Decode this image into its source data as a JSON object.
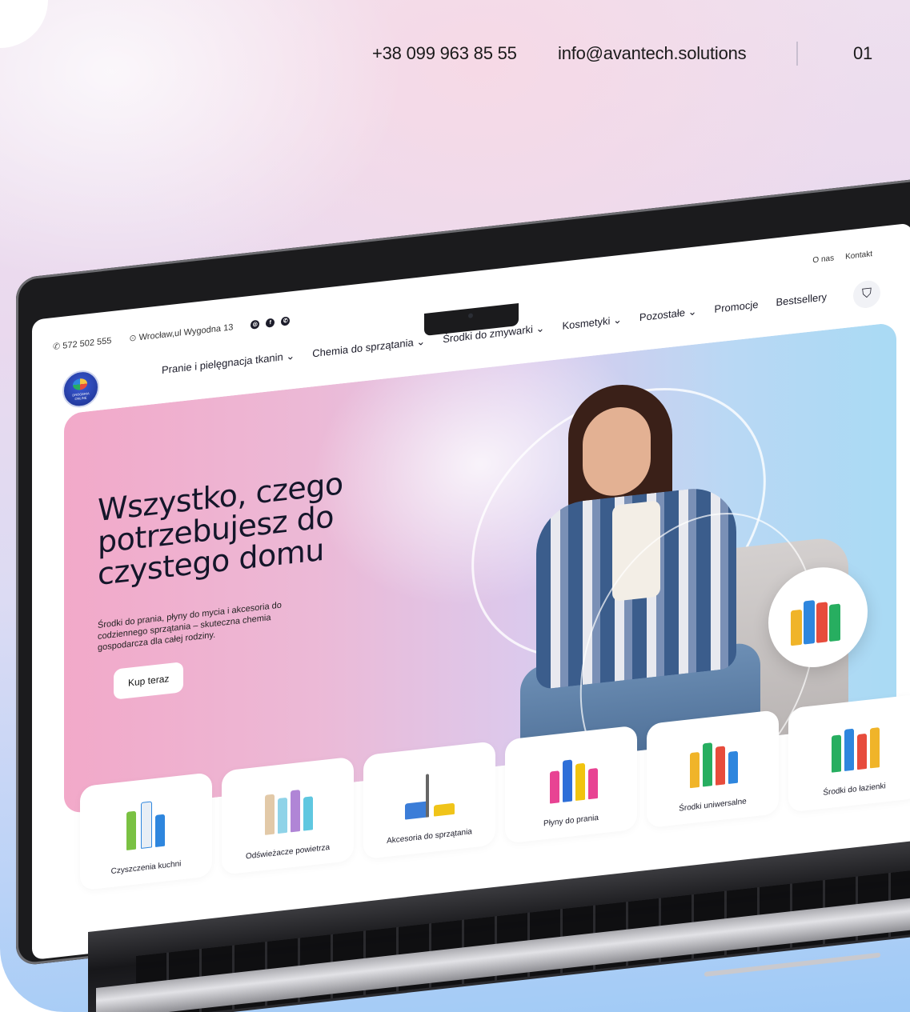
{
  "header": {
    "phone": "+38 099 963 85 55",
    "email": "info@avantech.solutions",
    "page_number": "01"
  },
  "site": {
    "topbar": {
      "phone": "572 502 555",
      "address": "Wrocław,ul Wygodna 13",
      "links": [
        "O nas",
        "Kontakt"
      ]
    },
    "logo_text": "DROGERIA ONLINE",
    "nav": [
      "Pranie i pielęgnacja tkanin ⌄",
      "Chemia do sprzątania ⌄",
      "Środki do zmywarki ⌄",
      "Kosmetyki ⌄",
      "Pozostałe ⌄",
      "Promocje",
      "Bestsellery"
    ],
    "hero": {
      "title": "Wszystko, czego potrzebujesz do czystego domu",
      "subtitle": "Środki do prania, płyny do mycia i akcesoria do codziennego sprzątania – skuteczna chemia gospodarcza dla całej rodziny.",
      "cta": "Kup teraz",
      "slider_prev": "‹",
      "slider_next": "›"
    },
    "categories": [
      "Czyszczenia kuchni",
      "Odświeżacze powietrza",
      "Akcesoria do sprzątania",
      "Płyny do prania",
      "Środki uniwersalne",
      "Środki do łazienki"
    ]
  }
}
